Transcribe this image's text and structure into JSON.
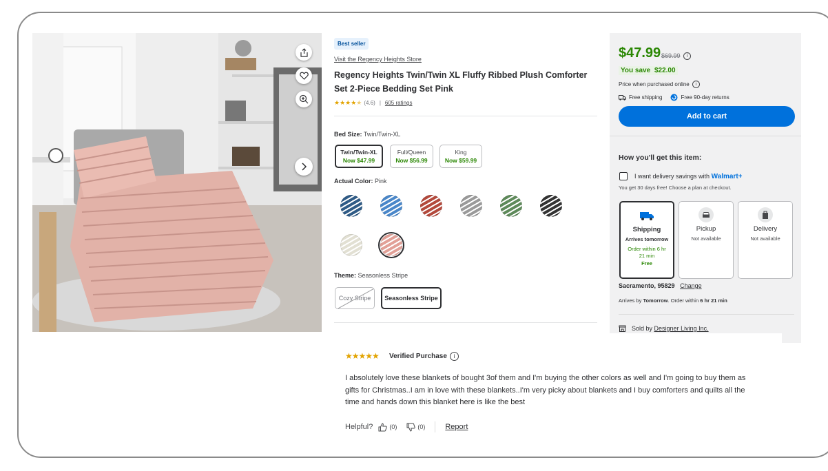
{
  "gallery": {
    "image_alt": "Pink ribbed plush comforter set on a bed",
    "share_icon": "share-icon",
    "favorite_icon": "heart-icon",
    "zoom_icon": "zoom-in-icon",
    "next_icon": "chevron-right-icon"
  },
  "product": {
    "badge": "Best seller",
    "store_link": "Visit the Regency Heights Store",
    "title": "Regency Heights Twin/Twin XL Fluffy Ribbed Plush Comforter Set 2-Piece Bedding Set Pink",
    "rating": "(4.6)",
    "rating_stars": 4.6,
    "separator": "|",
    "ratings_count": "605 ratings"
  },
  "bed_size": {
    "label": "Bed Size:",
    "value": "Twin/Twin-XL",
    "options": [
      {
        "name": "Twin/Twin-XL",
        "price": "Now $47.99",
        "selected": true
      },
      {
        "name": "Full/Queen",
        "price": "Now $56.99",
        "selected": false
      },
      {
        "name": "King",
        "price": "Now $59.99",
        "selected": false
      }
    ]
  },
  "color": {
    "label": "Actual Color:",
    "value": "Pink",
    "swatches": [
      {
        "name": "navy",
        "hex": "#2f5b86"
      },
      {
        "name": "blue",
        "hex": "#4a87c9"
      },
      {
        "name": "rust",
        "hex": "#b3493c"
      },
      {
        "name": "grey",
        "hex": "#9a9a9a"
      },
      {
        "name": "green",
        "hex": "#5e8a5a"
      },
      {
        "name": "black",
        "hex": "#333333"
      },
      {
        "name": "ivory",
        "hex": "#e2e0d3"
      },
      {
        "name": "pink",
        "hex": "#e2a097",
        "selected": true
      }
    ]
  },
  "theme": {
    "label": "Theme:",
    "value": "Seasonless Stripe",
    "options": [
      {
        "name": "Cozy Stripe",
        "available": false
      },
      {
        "name": "Seasonless Stripe",
        "selected": true
      }
    ]
  },
  "buy_box": {
    "price": "$47.99",
    "was_price": "$69.99",
    "you_save_label": "You save",
    "you_save_amount": "$22.00",
    "price_note": "Price when purchased online",
    "free_shipping": "Free shipping",
    "free_returns": "Free 90-day returns",
    "add_to_cart": "Add to cart",
    "how_heading": "How you'll get this item:",
    "delivery_savings": "I want delivery savings with",
    "walmart_plus": "Walmart+",
    "trial_note": "You get 30 days free! Choose a plan at checkout.",
    "fulfillment": [
      {
        "name": "Shipping",
        "line1": "Arrives tomorrow",
        "line2": "Order within 6 hr 21 min",
        "line3": "Free",
        "selected": true
      },
      {
        "name": "Pickup",
        "line1": "Not available"
      },
      {
        "name": "Delivery",
        "line1": "Not available"
      }
    ],
    "location": "Sacramento, 95829",
    "change": "Change",
    "arrives_prefix": "Arrives by",
    "arrives_day": "Tomorrow",
    "order_within_prefix": ". Order within",
    "order_within_time": "6 hr 21 min",
    "sold_by_label": "Sold by",
    "seller": "Designer Living Inc."
  },
  "review": {
    "stars": 5,
    "star_glyphs": "★★★★★",
    "verified": "Verified Purchase",
    "text": "I absolutely love these blankets of bought 3of them and I'm buying the other colors as well and I'm going to buy them as gifts for Christmas..I am in love with these blankets..I'm very picky about blankets and I buy comforters and quilts all the time and hands down this blanket here is like the best",
    "helpful_label": "Helpful?",
    "up_count": "(0)",
    "down_count": "(0)",
    "report": "Report"
  },
  "colors": {
    "accent": "#0071dc",
    "price_green": "#2a8703"
  }
}
